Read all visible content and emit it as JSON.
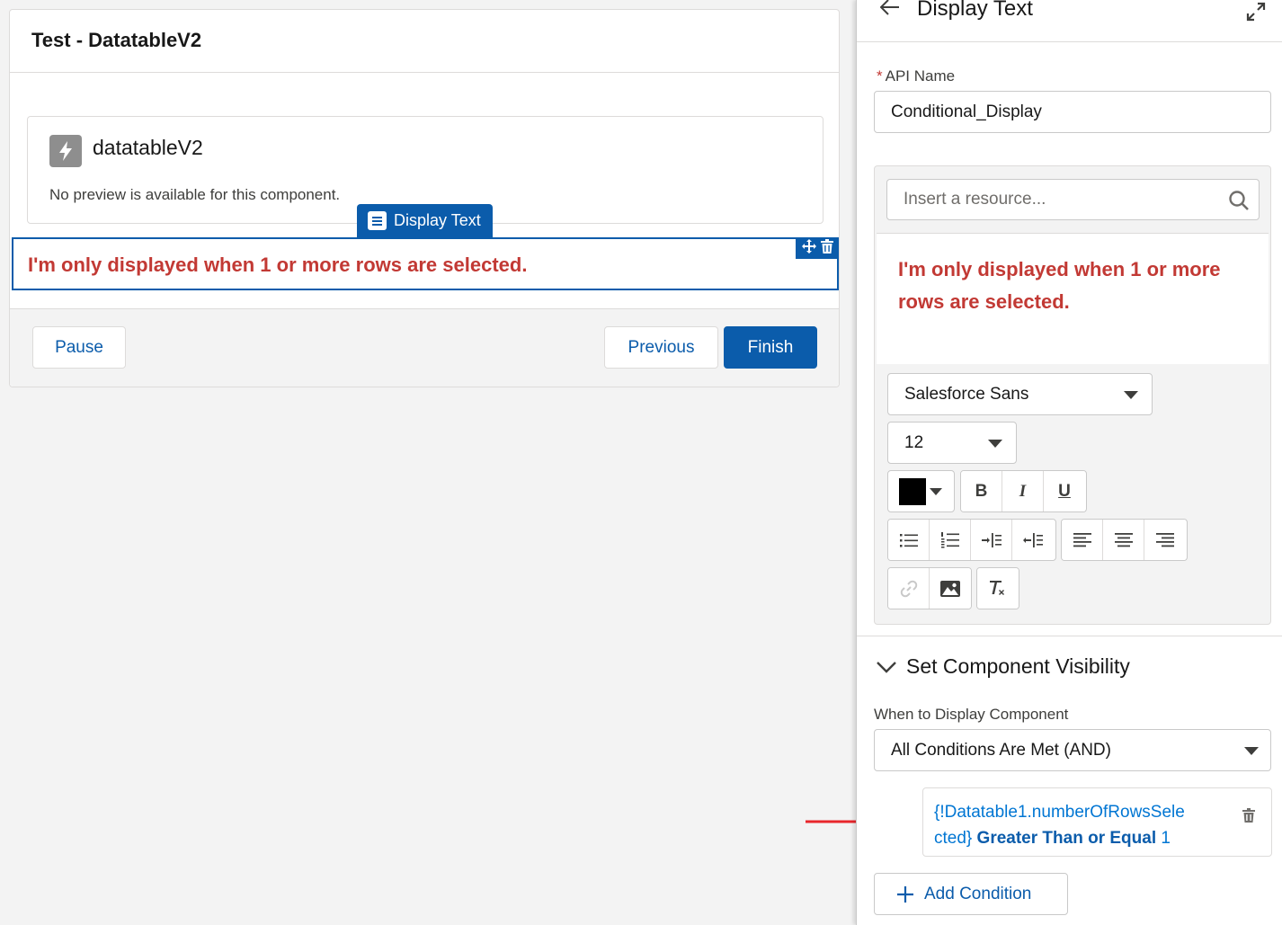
{
  "canvas": {
    "screen_title": "Test - DatatableV2",
    "component": {
      "name": "datatableV2",
      "preview_message": "No preview is available for this component."
    },
    "selected_tag": "Display Text",
    "selected_text": "I'm only displayed when 1 or more rows are selected.",
    "footer": {
      "pause_label": "Pause",
      "previous_label": "Previous",
      "finish_label": "Finish"
    }
  },
  "panel": {
    "title": "Display Text",
    "api_name": {
      "label": "API Name",
      "required_marker": "*",
      "value": "Conditional_Display"
    },
    "rich_text": {
      "search_placeholder": "Insert a resource...",
      "content": "I'm only displayed when 1 or more rows are selected.",
      "font_family": "Salesforce Sans",
      "font_size": "12",
      "text_color": "#000000"
    },
    "visibility": {
      "section_title": "Set Component Visibility",
      "when_label": "When to Display Component",
      "when_value": "All Conditions Are Met (AND)",
      "condition": {
        "resource_line1": "{!Datatable1.numberOfRowsSele",
        "resource_line2": "cted}",
        "operator": "Greater Than or Equal",
        "value": "1"
      },
      "add_condition_label": "Add Condition"
    }
  },
  "colors": {
    "brand": "#0b5cab",
    "error_text": "#c23934",
    "link": "#0176d3",
    "annotation_arrow": "#e8262b"
  }
}
